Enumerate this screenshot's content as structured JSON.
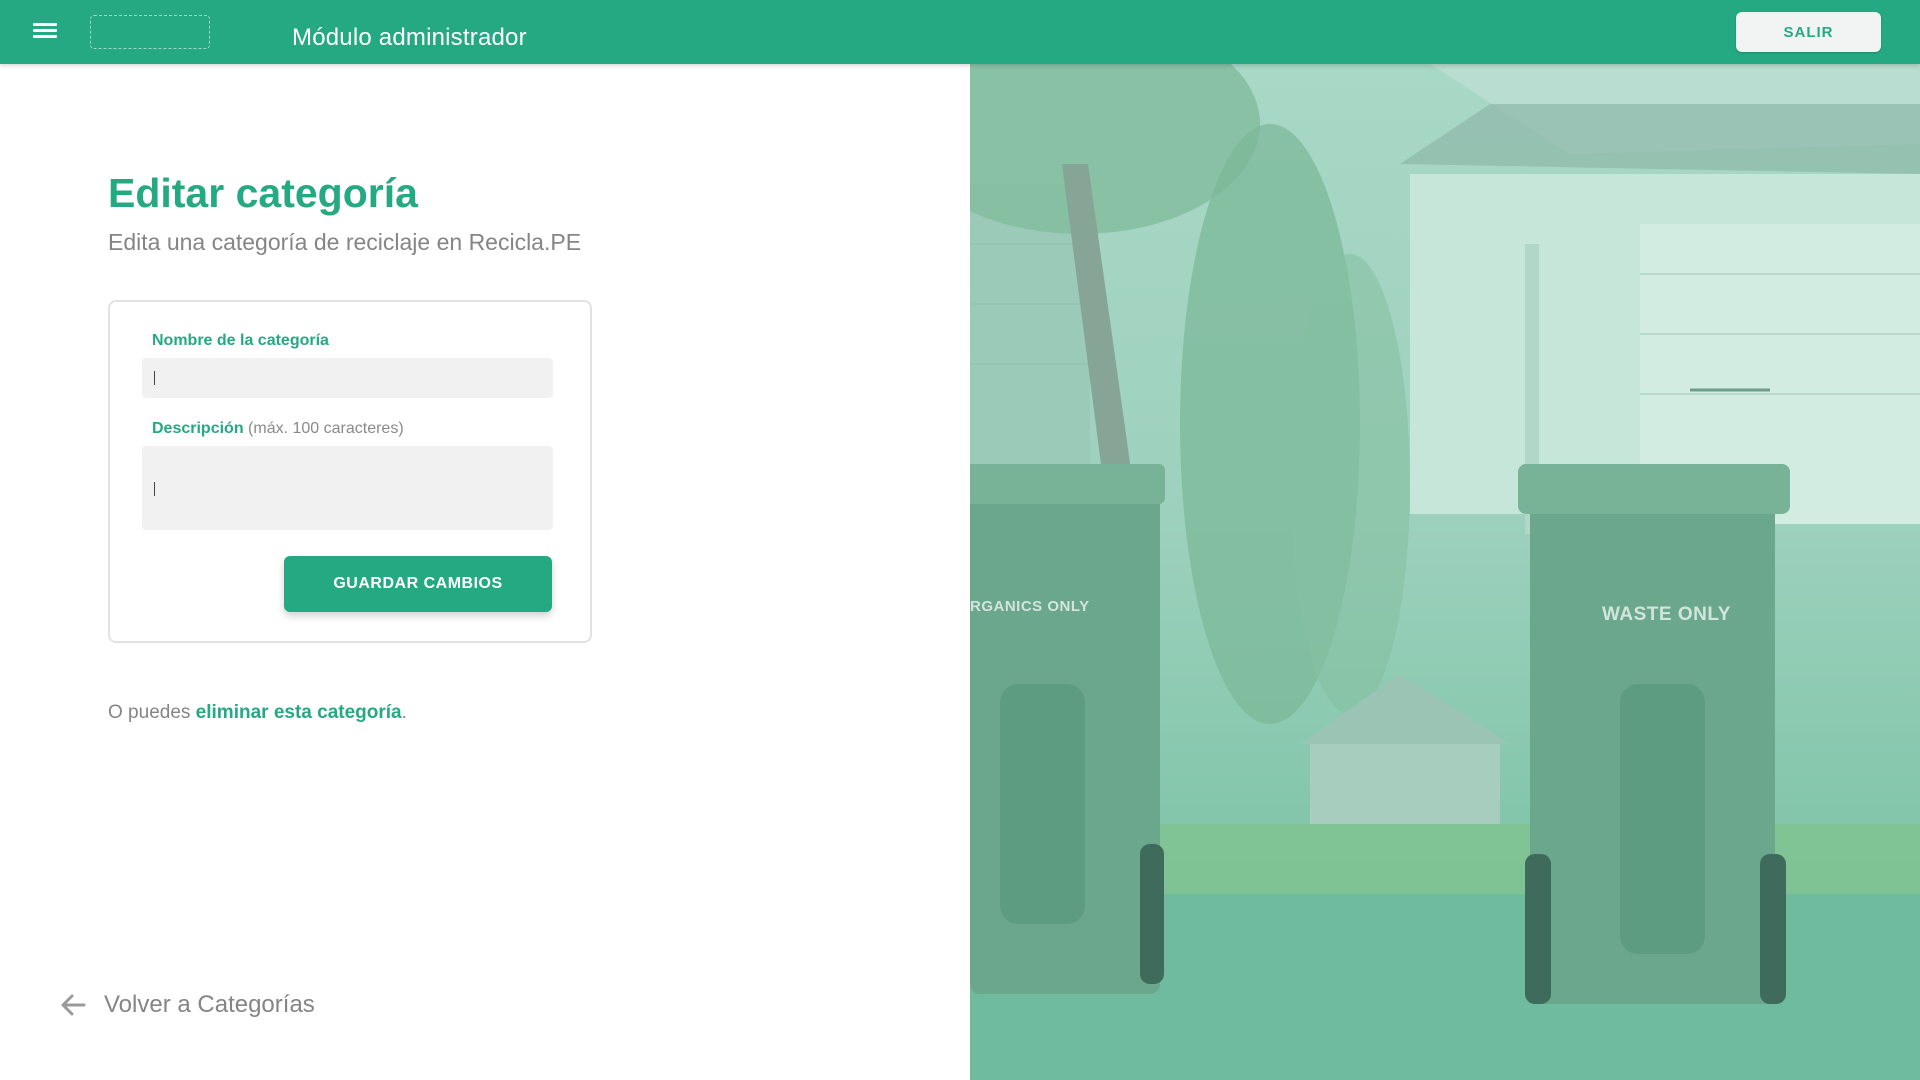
{
  "header": {
    "module_title": "Módulo administrador",
    "logout_label": "SALIR"
  },
  "page": {
    "title": "Editar categoría",
    "subtitle": "Edita una categoría de reciclaje en Recicla.PE"
  },
  "form": {
    "name_label": "Nombre de la categoría",
    "name_value": "",
    "description_label": "Descripción",
    "description_hint": "(máx. 100 caracteres)",
    "description_value": "",
    "save_label": "GUARDAR CAMBIOS"
  },
  "delete": {
    "prefix": "O puedes ",
    "link_label": "eliminar esta categoría",
    "suffix": "."
  },
  "back": {
    "label": "Volver a Categorías"
  },
  "image": {
    "bin_left_label": "RGANICS ONLY",
    "bin_right_label": "WASTE ONLY"
  },
  "colors": {
    "primary": "#25a983",
    "muted_text": "#858585",
    "input_bg": "#f1f1f1"
  }
}
